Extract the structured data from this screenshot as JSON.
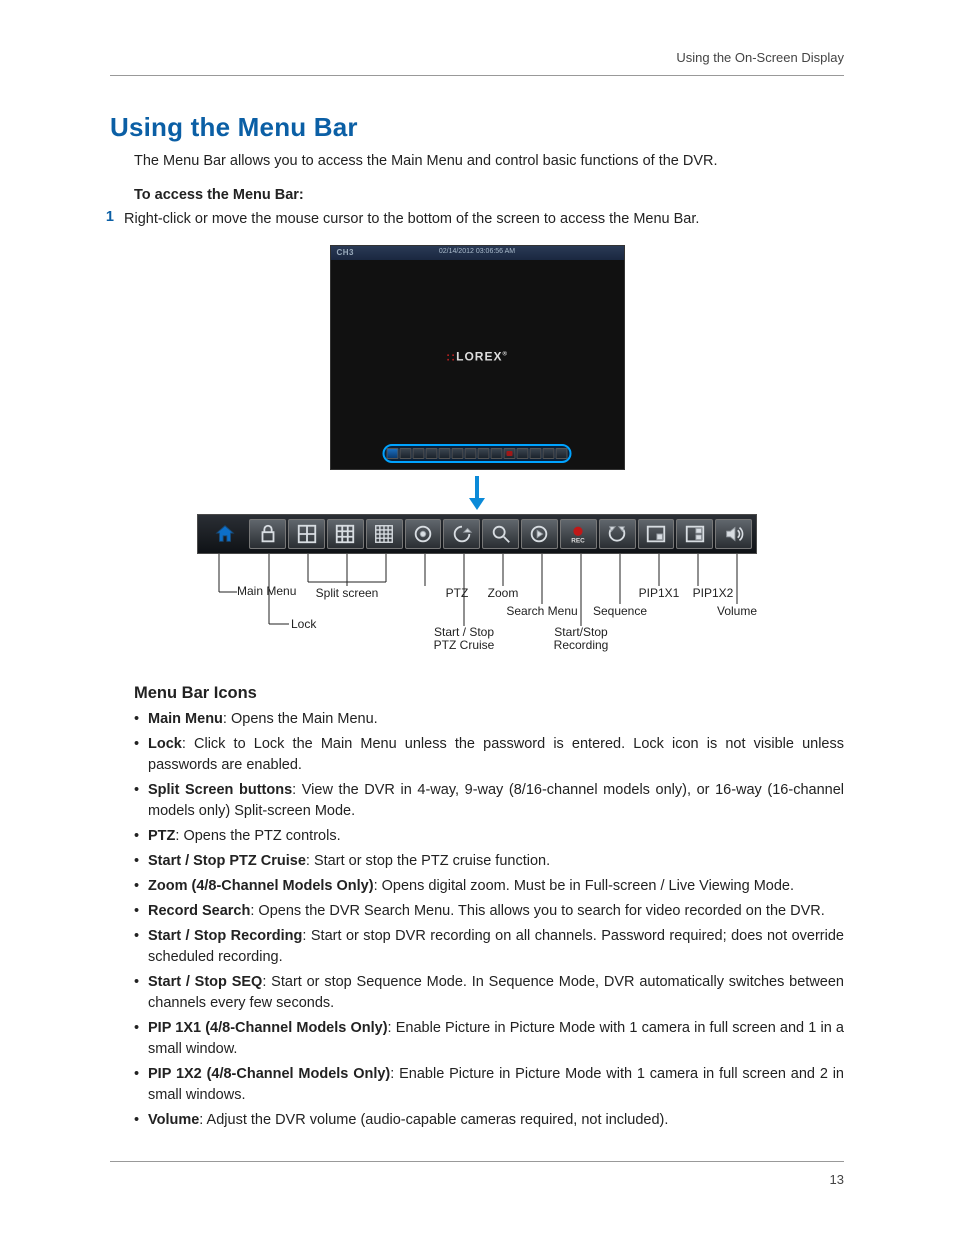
{
  "header": {
    "breadcrumb": "Using the On-Screen Display"
  },
  "title": "Using the Menu Bar",
  "intro": "The Menu Bar allows you to access the Main Menu and control basic functions of the DVR.",
  "access_heading": "To access the Menu Bar:",
  "step1_num": "1",
  "step1_text": "Right-click or move the mouse cursor to the bottom of the screen to access the Menu Bar.",
  "screenshot": {
    "channel": "CH3",
    "timestamp": "02/14/2012 03:06:56 AM",
    "brand": "LOREX"
  },
  "callouts": {
    "main_menu": "Main Menu",
    "lock": "Lock",
    "split": "Split screen",
    "ptz": "PTZ",
    "ptz_cruise_l1": "Start / Stop",
    "ptz_cruise_l2": "PTZ Cruise",
    "zoom": "Zoom",
    "search": "Search Menu",
    "recording_l1": "Start/Stop",
    "recording_l2": "Recording",
    "sequence": "Sequence",
    "pip1x1": "PIP1X1",
    "pip1x2": "PIP1X2",
    "volume": "Volume"
  },
  "icons_heading": "Menu Bar Icons",
  "bullets": [
    {
      "term": "Main Menu",
      "desc": ": Opens the Main Menu."
    },
    {
      "term": "Lock",
      "desc": ": Click to Lock the Main Menu unless the password is entered. Lock icon is not visible unless passwords are enabled."
    },
    {
      "term": "Split Screen buttons",
      "desc": ": View the DVR in 4-way, 9-way (8/16-channel models only), or 16-way (16-channel models only) Split-screen Mode."
    },
    {
      "term": "PTZ",
      "desc": ": Opens the PTZ controls."
    },
    {
      "term": "Start / Stop PTZ Cruise",
      "desc": ": Start or stop the PTZ cruise function."
    },
    {
      "term": "Zoom (4/8-Channel Models Only)",
      "desc": ": Opens digital zoom. Must be in Full-screen / Live Viewing Mode."
    },
    {
      "term": "Record Search",
      "desc": ": Opens the DVR Search Menu. This allows you to search for video recorded on the DVR."
    },
    {
      "term": "Start / Stop Recording",
      "desc": ": Start or stop DVR recording on all channels. Password required; does not override scheduled recording."
    },
    {
      "term": "Start / Stop SEQ",
      "desc": ": Start or stop Sequence Mode. In Sequence Mode, DVR automatically switches between channels every few seconds."
    },
    {
      "term": "PIP 1X1 (4/8-Channel Models Only)",
      "desc": ": Enable Picture in Picture Mode with 1 camera in full screen and 1 in a small window."
    },
    {
      "term": "PIP 1X2 (4/8-Channel Models Only)",
      "desc": ": Enable Picture in Picture Mode with 1 camera in full screen and 2 in small windows."
    },
    {
      "term": "Volume",
      "desc": ": Adjust the DVR volume (audio-capable cameras required, not included)."
    }
  ],
  "page_number": "13"
}
